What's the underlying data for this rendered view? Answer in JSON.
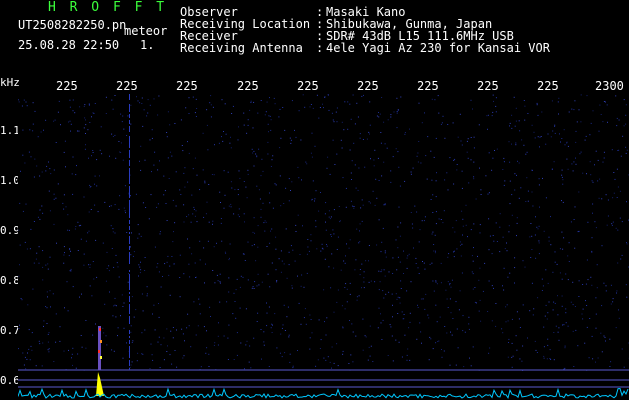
{
  "header": {
    "brand": "H R O F F T",
    "filename": "UT2508282250.pn",
    "type": "meteor",
    "datetime": "25.08.28 22:50",
    "count": "1.",
    "observer_label": "Observer",
    "observer": "Masaki Kano",
    "location_label": "Receiving Location",
    "location": "Shibukawa, Gunma, Japan",
    "receiver_label": "Receiver",
    "receiver": "SDR# 43dB L15 111.6MHz USB",
    "antenna_label": "Receiving Antenna",
    "antenna": "4ele Yagi Az 230 for Kansai VOR",
    "separator": ":"
  },
  "axis": {
    "unit": "kHz",
    "x_ticks": [
      "225",
      "225",
      "225",
      "225",
      "225",
      "225",
      "225",
      "225",
      "225",
      "2300"
    ],
    "y_ticks": [
      "1.1",
      "1.0",
      "0.9",
      "0.8",
      "0.7",
      "0.6"
    ]
  },
  "colors": {
    "background": "#000000",
    "noise": "#1a2a8c",
    "brand": "#3cff3c",
    "trace": "#00c8ff",
    "echo": "#ffff00"
  }
}
